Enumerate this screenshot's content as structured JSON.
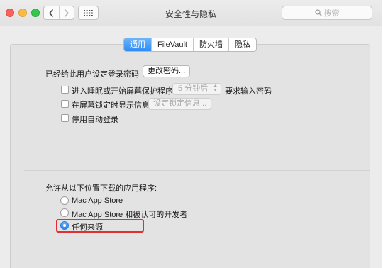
{
  "window": {
    "title": "安全性与隐私",
    "search_placeholder": "搜索"
  },
  "tabs": [
    {
      "label": "通用",
      "active": true
    },
    {
      "label": "FileVault",
      "active": false
    },
    {
      "label": "防火墙",
      "active": false
    },
    {
      "label": "隐私",
      "active": false
    }
  ],
  "general": {
    "password_set_label": "已经给此用户设定登录密码",
    "change_password_button": "更改密码...",
    "require_password": {
      "checked": false,
      "prefix": "进入睡眠或开始屏幕保护程序",
      "delay_value": "5 分钟后",
      "suffix": "要求输入密码"
    },
    "show_message": {
      "checked": false,
      "label": "在屏幕锁定时显示信息",
      "button": "设定锁定信息..."
    },
    "disable_auto_login": {
      "checked": false,
      "label": "停用自动登录"
    }
  },
  "downloads": {
    "heading": "允许从以下位置下载的应用程序:",
    "options": [
      {
        "label": "Mac App Store",
        "selected": false
      },
      {
        "label": "Mac App Store 和被认可的开发者",
        "selected": false
      },
      {
        "label": "任何来源",
        "selected": true
      }
    ]
  },
  "colors": {
    "accent": "#2f8cf5",
    "highlight_border": "#e03030"
  }
}
